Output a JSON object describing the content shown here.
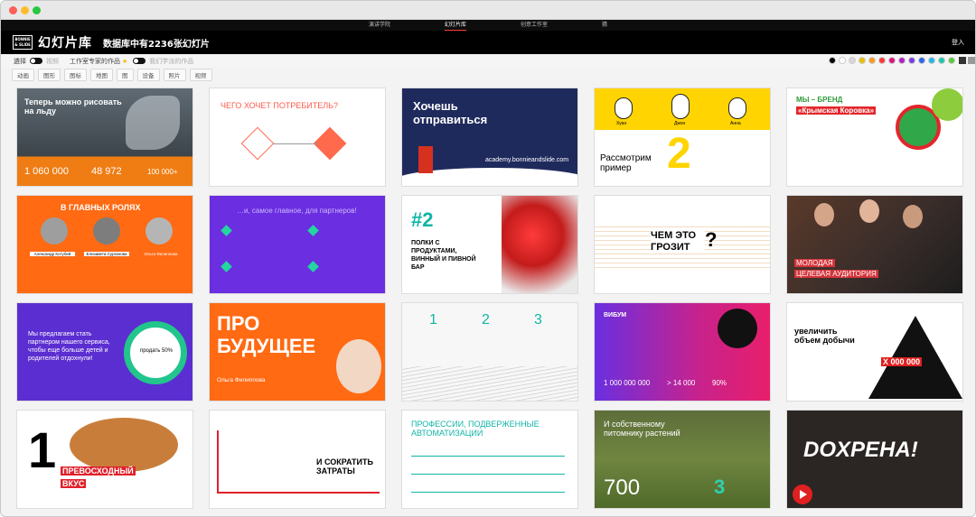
{
  "nav": {
    "tabs": [
      "演讲学院",
      "幻灯片库",
      "创意工作室",
      "猜"
    ],
    "active_tab": "幻灯片库"
  },
  "header": {
    "logo_line1": "BONNIE",
    "logo_line2": "& SLIDE",
    "title": "幻灯片库",
    "subtitle": "数据库中有2236张幻灯片",
    "login": "登入"
  },
  "toolbar": {
    "choose_label": "遴择",
    "toggle_a_label": "视频",
    "expert_label": "工作室专家的作品",
    "toggle_b_label": "我们学派的作品",
    "swatch_colors": [
      "#000000",
      "#ffffff",
      "#d8d8d8",
      "#e8c000",
      "#ff9b1a",
      "#ff3a3a",
      "#e0147c",
      "#b01fc9",
      "#7a3fe0",
      "#2f68e8",
      "#26b6e6",
      "#1fc6a8",
      "#58c93e"
    ]
  },
  "filters": [
    "动画",
    "图形",
    "图标",
    "地图",
    "图",
    "设备",
    "照片",
    "视频"
  ],
  "cards": {
    "c11_title": "Теперь можно рисовать на льду",
    "c11_n1": "1 060 000",
    "c11_n2": "48 972",
    "c11_n3": "100 000+",
    "c12_title": "ЧЕГО ХОЧЕТ ПОТРЕБИТЕЛЬ?",
    "c13_title": "Хочешь отправиться",
    "c13_link": "academy.bonnieandslide.com",
    "c14_names": [
      "Хуан",
      "Джон",
      "Анна"
    ],
    "c14_title": "Рассмотрим пример",
    "c14_num": "2",
    "c15_top": "МЫ – БРЕНД",
    "c15_brand": "«Крымская Коровка»",
    "c21_title": "В ГЛАВНЫХ РОЛЯХ",
    "c21_names": [
      "Александр Котубей",
      "Елизавета Сурганова",
      "Ольга Филиппова"
    ],
    "c22_title": "…и, самое главное, для партнеров!",
    "c23_num": "#2",
    "c23_text": "ПОЛКИ С ПРОДУКТАМИ, ВИННЫЙ И ПИВНОЙ БАР",
    "c24_title": "ЧЕМ ЭТО ГРОЗИТ",
    "c24_q": "?",
    "c25_line1": "МОЛОДАЯ",
    "c25_line2": "ЦЕЛЕВАЯ АУДИТОРИЯ",
    "c31_text": "Мы предлагаем стать партнером нашего сервиса, чтобы еще больше детей и родителей отдохнули!",
    "c31_ring": "продать 50%",
    "c32_title": "ПРО БУДУЩЕЕ",
    "c32_name": "Ольга Филиппова",
    "c33_nums": [
      "1",
      "2",
      "3"
    ],
    "c34_brand": "ВИБУМ",
    "c34_n1": "1 000 000 000",
    "c34_n2": "> 14 000",
    "c34_n3": "90%",
    "c35_title": "увеличить объем добычи",
    "c35_num": "X 000 000",
    "c41_num": "1",
    "c41_label1": "ПРЕВОСХОДНЫЙ",
    "c41_label2": "ВКУС",
    "c42_title": "И СОКРАТИТЬ ЗАТРАТЫ",
    "c43_title": "ПРОФЕССИИ, ПОДВЕРЖЕННЫЕ АВТОМАТИЗАЦИИ",
    "c44_title": "И собственному питомнику растений",
    "c44_num": "700",
    "c44_num2": "3",
    "c45_title": "DOXPEHA!"
  }
}
